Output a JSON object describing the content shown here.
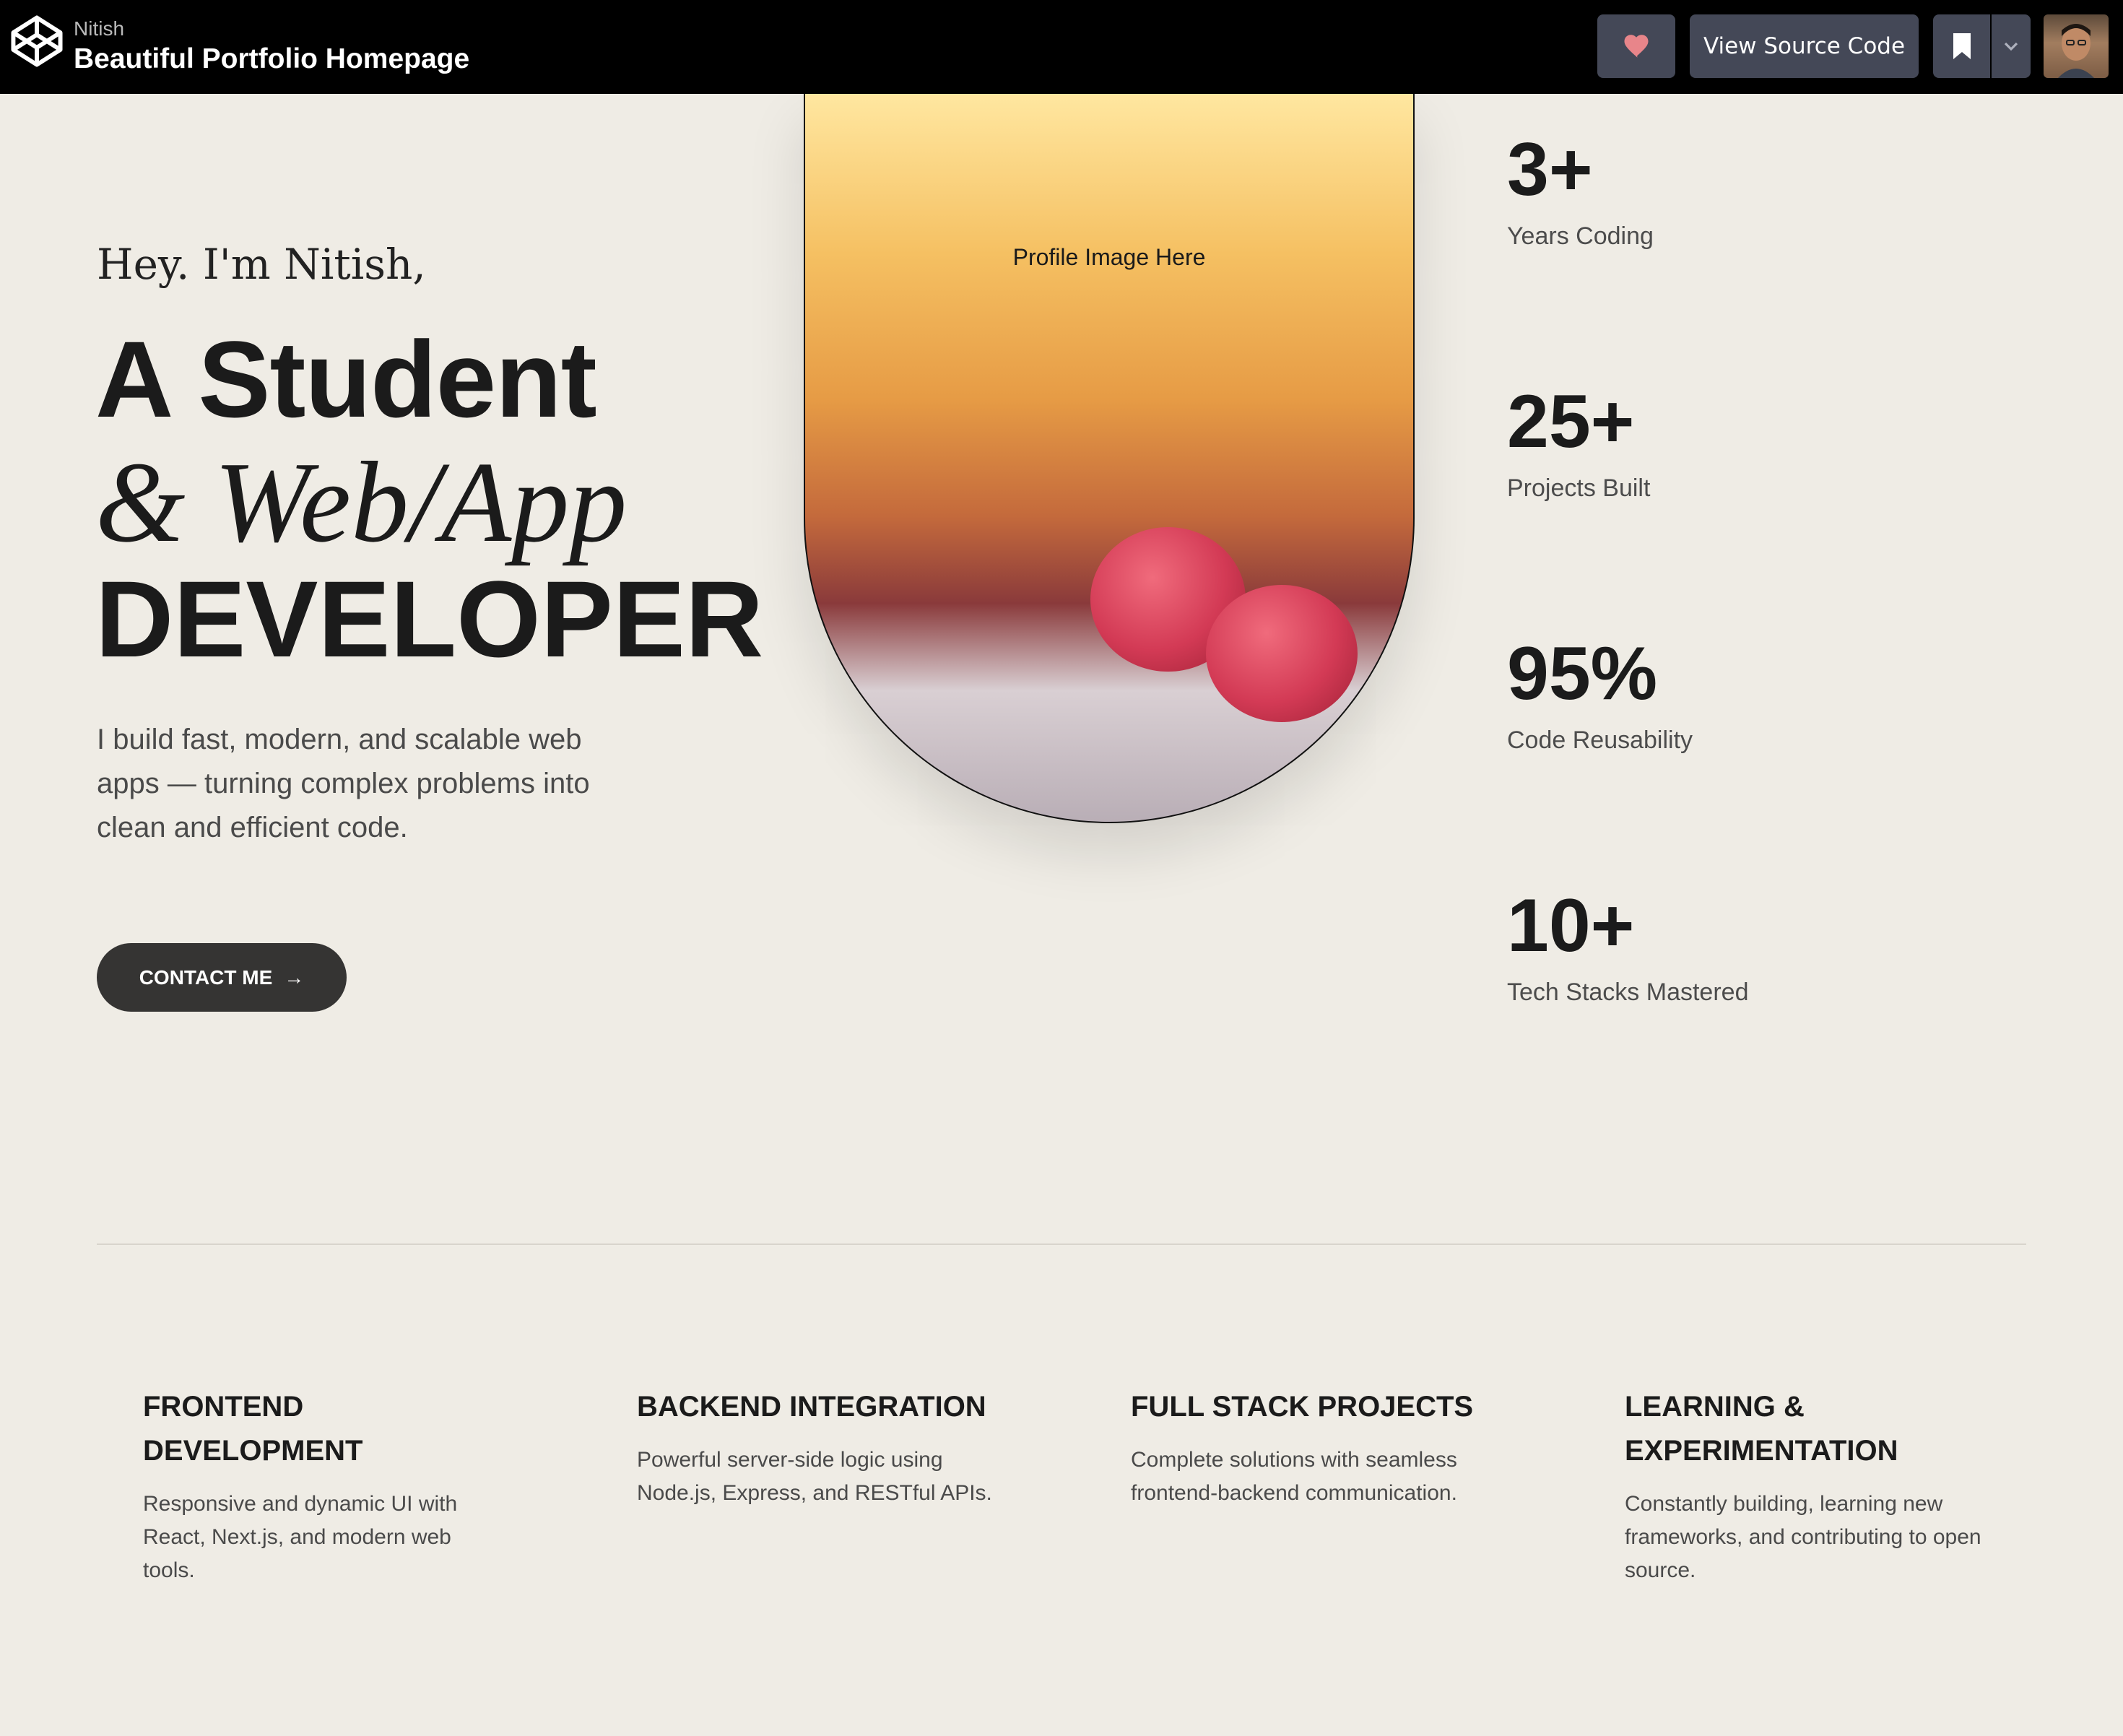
{
  "topbar": {
    "author": "Nitish",
    "title": "Beautiful Portfolio Homepage",
    "source_button": "View Source Code",
    "heart_icon": "heart-icon",
    "bookmark_icon": "bookmark-icon",
    "dropdown_icon": "chevron-down-icon",
    "heart_color": "#e8858a",
    "button_bg": "#444857"
  },
  "hero": {
    "greeting": "Hey. I'm Nitish,",
    "headline_line1": "A Student",
    "headline_line2": "& Web/App",
    "headline_line3": "DEVELOPER",
    "intro": "I build fast, modern, and scalable web apps — turning complex problems into clean and efficient code.",
    "contact_label": "CONTACT ME",
    "contact_arrow": "→",
    "profile_label": "Profile Image Here"
  },
  "stats": [
    {
      "value": "3+",
      "label": "Years Coding"
    },
    {
      "value": "25+",
      "label": "Projects Built"
    },
    {
      "value": "95%",
      "label": "Code Reusability"
    },
    {
      "value": "10+",
      "label": "Tech Stacks Mastered"
    }
  ],
  "services": [
    {
      "title": "FRONTEND DEVELOPMENT",
      "desc": "Responsive and dynamic UI with React, Next.js, and modern web tools."
    },
    {
      "title": "BACKEND INTEGRATION",
      "desc": "Powerful server-side logic using Node.js, Express, and RESTful APIs."
    },
    {
      "title": "FULL STACK PROJECTS",
      "desc": "Complete solutions with seamless frontend-backend communication."
    },
    {
      "title": "LEARNING & EXPERIMENTATION",
      "desc": "Constantly building, learning new frameworks, and contributing to open source."
    }
  ],
  "colors": {
    "page_bg": "#efece5",
    "text": "#1b1b1b",
    "muted": "#4a4a4a",
    "button_dark": "#353433"
  }
}
